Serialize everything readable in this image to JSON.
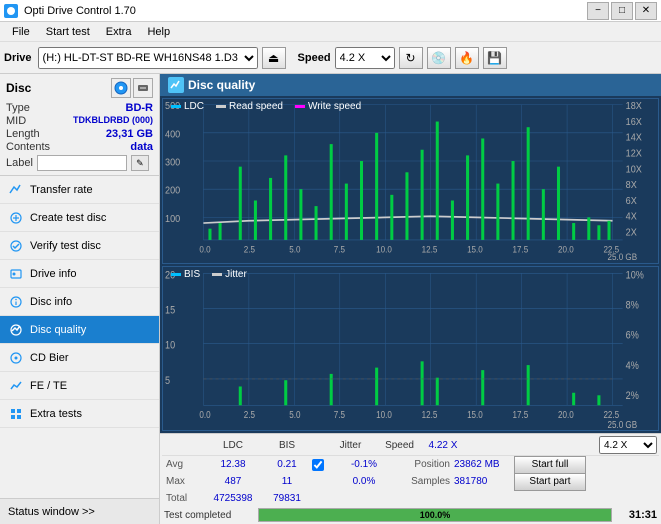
{
  "titleBar": {
    "title": "Opti Drive Control 1.70",
    "minimizeLabel": "−",
    "maximizeLabel": "□",
    "closeLabel": "✕"
  },
  "menuBar": {
    "items": [
      "File",
      "Start test",
      "Extra",
      "Help"
    ]
  },
  "toolbar": {
    "driveLabel": "Drive",
    "driveValue": "(H:) HL-DT-ST BD-RE  WH16NS48 1.D3",
    "speedLabel": "Speed",
    "speedValue": "4.2 X"
  },
  "sidebar": {
    "discSection": {
      "label": "Disc",
      "typeLabel": "Type",
      "typeValue": "BD-R",
      "midLabel": "MID",
      "midValue": "TDKBLDRBD (000)",
      "lengthLabel": "Length",
      "lengthValue": "23,31 GB",
      "contentsLabel": "Contents",
      "contentsValue": "data",
      "labelLabel": "Label",
      "labelValue": ""
    },
    "navItems": [
      {
        "id": "transfer-rate",
        "label": "Transfer rate",
        "active": false
      },
      {
        "id": "create-test-disc",
        "label": "Create test disc",
        "active": false
      },
      {
        "id": "verify-test-disc",
        "label": "Verify test disc",
        "active": false
      },
      {
        "id": "drive-info",
        "label": "Drive info",
        "active": false
      },
      {
        "id": "disc-info",
        "label": "Disc info",
        "active": false
      },
      {
        "id": "disc-quality",
        "label": "Disc quality",
        "active": true
      },
      {
        "id": "cd-bier",
        "label": "CD Bier",
        "active": false
      },
      {
        "id": "fe-te",
        "label": "FE / TE",
        "active": false
      },
      {
        "id": "extra-tests",
        "label": "Extra tests",
        "active": false
      }
    ],
    "statusWindow": "Status window >>"
  },
  "chartArea": {
    "title": "Disc quality",
    "chart1": {
      "legend": [
        {
          "label": "LDC",
          "color": "#00bfff"
        },
        {
          "label": "Read speed",
          "color": "#cccccc"
        },
        {
          "label": "Write speed",
          "color": "#ff00ff"
        }
      ],
      "yAxisMax": 500,
      "yAxisLabels": [
        "500",
        "400",
        "300",
        "200",
        "100"
      ],
      "xAxisLabels": [
        "0.0",
        "2.5",
        "5.0",
        "7.5",
        "10.0",
        "12.5",
        "15.0",
        "17.5",
        "20.0",
        "22.5",
        "25.0 GB"
      ],
      "rightLabels": [
        "18X",
        "16X",
        "14X",
        "12X",
        "10X",
        "8X",
        "6X",
        "4X",
        "2X"
      ]
    },
    "chart2": {
      "legend": [
        {
          "label": "BIS",
          "color": "#00bfff"
        },
        {
          "label": "Jitter",
          "color": "#cccccc"
        }
      ],
      "yAxisMax": 20,
      "yAxisLabels": [
        "20",
        "15",
        "10",
        "5"
      ],
      "xAxisLabels": [
        "0.0",
        "2.5",
        "5.0",
        "7.5",
        "10.0",
        "12.5",
        "15.0",
        "17.5",
        "20.0",
        "22.5",
        "25.0 GB"
      ],
      "rightLabels": [
        "10%",
        "8%",
        "6%",
        "4%",
        "2%"
      ]
    }
  },
  "statsArea": {
    "colHeaders": [
      "LDC",
      "BIS",
      "",
      "Jitter",
      "Speed",
      ""
    ],
    "rows": [
      {
        "label": "Avg",
        "ldc": "12.38",
        "bis": "0.21",
        "jitter": "-0.1%",
        "speed": "4.22 X"
      },
      {
        "label": "Max",
        "ldc": "487",
        "bis": "11",
        "jitter": "0.0%",
        "position": "23862 MB"
      },
      {
        "label": "Total",
        "ldc": "4725398",
        "bis": "79831",
        "jitter": "",
        "samples": "381780"
      }
    ],
    "jitterChecked": true,
    "jitterLabel": "Jitter",
    "speedLabel": "Speed",
    "speedValue": "4.22 X",
    "speedSelectValue": "4.2 X",
    "positionLabel": "Position",
    "positionValue": "23862 MB",
    "samplesLabel": "Samples",
    "samplesValue": "381780",
    "startFullLabel": "Start full",
    "startPartLabel": "Start part",
    "progressPercent": 100,
    "progressLabel": "100.0%",
    "statusText": "Test completed",
    "timeText": "31:31"
  }
}
